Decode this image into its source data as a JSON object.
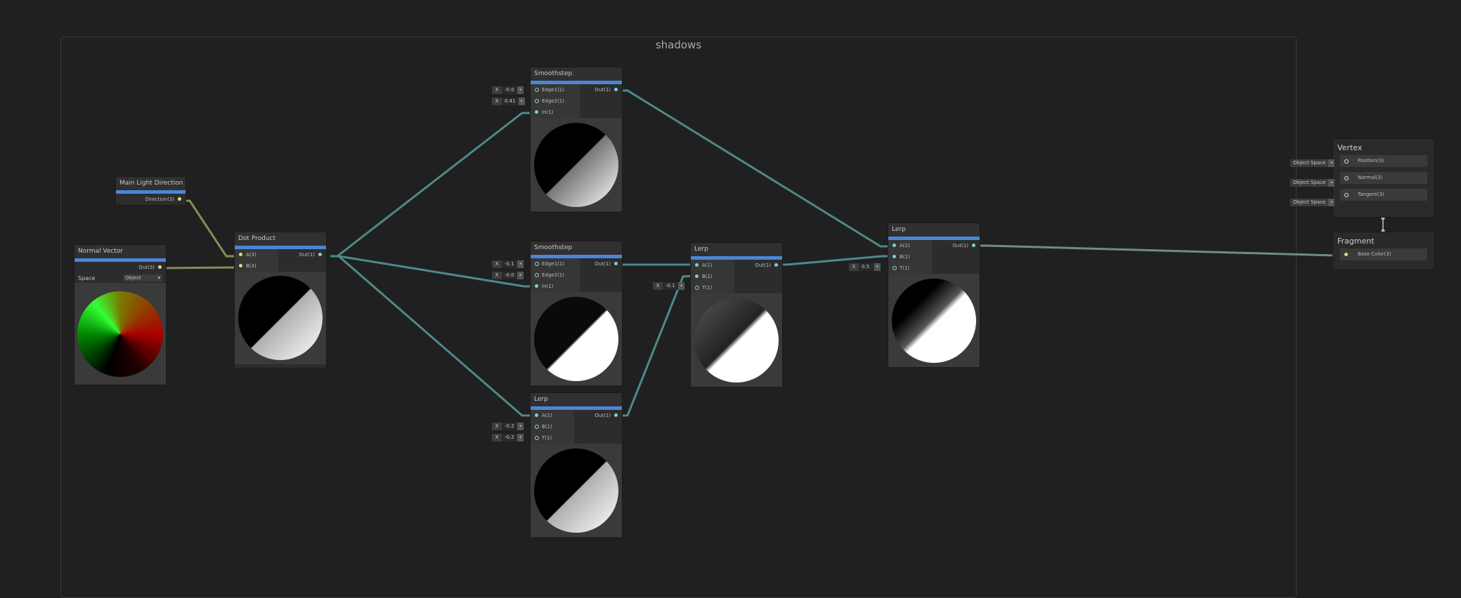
{
  "graph": {
    "title": "shadows"
  },
  "nodes": {
    "main_light": {
      "title": "Main Light Direction",
      "out": "Direction(3)"
    },
    "normal_vector": {
      "title": "Normal Vector",
      "out": "Out(3)",
      "space_label": "Space",
      "space_value": "Object",
      "dropdown_arrow": "▾"
    },
    "dot_product": {
      "title": "Dot Product",
      "in_a": "A(3)",
      "in_b": "B(3)",
      "out": "Out(1)"
    },
    "smooth1": {
      "title": "Smoothstep",
      "in1": "Edge1(1)",
      "in2": "Edge2(1)",
      "in3": "In(1)",
      "out": "Out(1)",
      "f1": "-0.0",
      "f2": "0.41"
    },
    "smooth2": {
      "title": "Smoothstep",
      "in1": "Edge1(1)",
      "in2": "Edge2(1)",
      "in3": "In(1)",
      "out": "Out(1)",
      "f1": "-0.1",
      "f2": "-0.0"
    },
    "lerp1": {
      "title": "Lerp",
      "in1": "A(1)",
      "in2": "B(1)",
      "in3": "T(1)",
      "out": "Out(1)",
      "f2": "-0.2",
      "f3": "-0.2"
    },
    "lerp2": {
      "title": "Lerp",
      "in1": "A(1)",
      "in2": "B(1)",
      "in3": "T(1)",
      "out": "Out(1)",
      "f3": "-0.1"
    },
    "lerp3": {
      "title": "Lerp",
      "in1": "A(1)",
      "in2": "B(1)",
      "in3": "T(1)",
      "out": "Out(1)",
      "f3": "0.5"
    }
  },
  "field_prefix": "X",
  "pip": "•",
  "vertex": {
    "title": "Vertex",
    "slots": [
      "Position(3)",
      "Normal(3)",
      "Tangent(3)"
    ],
    "space": "Object Space"
  },
  "fragment": {
    "title": "Fragment",
    "slots": [
      "Base Color(3)"
    ]
  },
  "colors": {
    "accent": "#4a86d8",
    "wire_teal": "#4e8a8a",
    "wire_yellow": "#8a8a5a",
    "background": "#202020"
  }
}
